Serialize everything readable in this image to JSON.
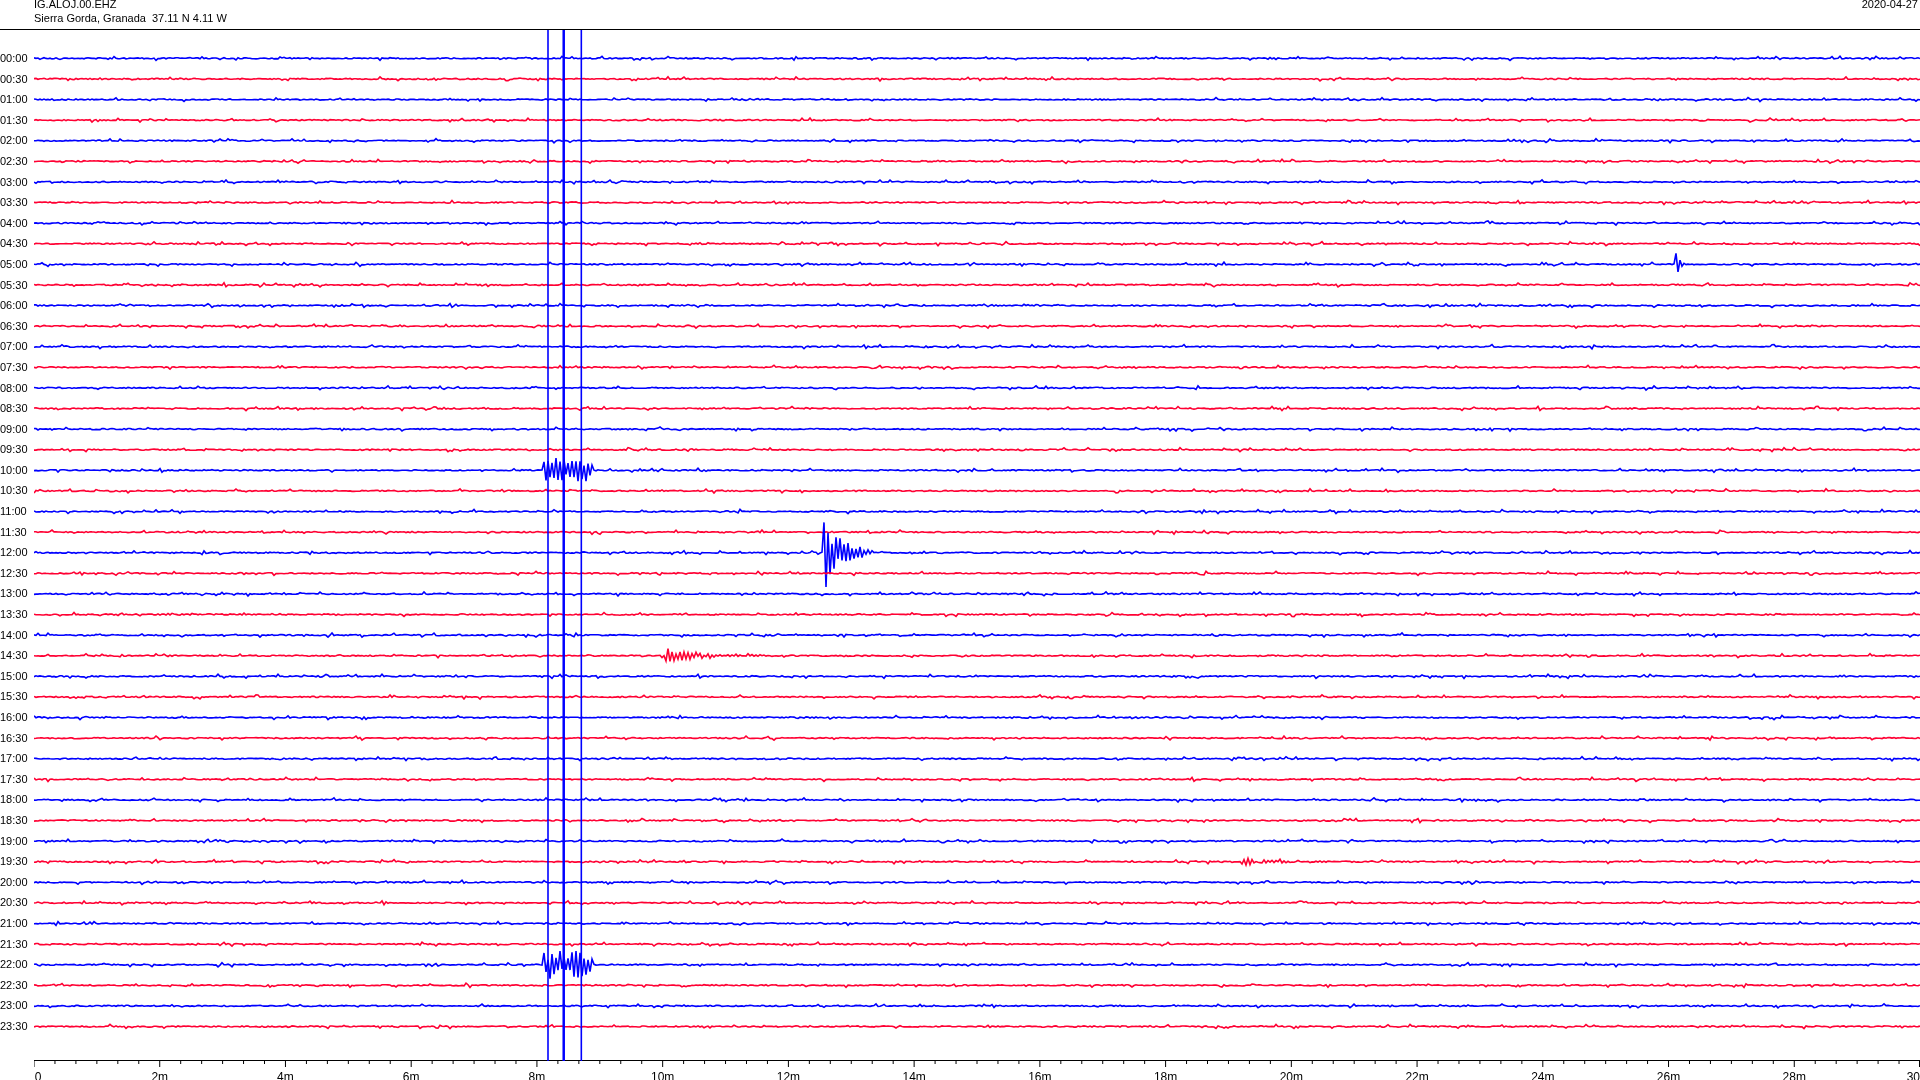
{
  "header": {
    "station": "IG.ALOJ.00.EHZ",
    "location": "Sierra Gorda, Granada  37.11 N 4.11 W",
    "date": "2020-04-27"
  },
  "rows": [
    {
      "time": "00:00",
      "color": "#0000ff"
    },
    {
      "time": "00:30",
      "color": "#ff0033"
    },
    {
      "time": "01:00",
      "color": "#0000ff"
    },
    {
      "time": "01:30",
      "color": "#ff0033"
    },
    {
      "time": "02:00",
      "color": "#0000ff"
    },
    {
      "time": "02:30",
      "color": "#ff0033"
    },
    {
      "time": "03:00",
      "color": "#0000ff"
    },
    {
      "time": "03:30",
      "color": "#ff0033"
    },
    {
      "time": "04:00",
      "color": "#0000ff"
    },
    {
      "time": "04:30",
      "color": "#ff0033"
    },
    {
      "time": "05:00",
      "color": "#0000ff"
    },
    {
      "time": "05:30",
      "color": "#ff0033"
    },
    {
      "time": "06:00",
      "color": "#0000ff"
    },
    {
      "time": "06:30",
      "color": "#ff0033"
    },
    {
      "time": "07:00",
      "color": "#0000ff"
    },
    {
      "time": "07:30",
      "color": "#ff0033"
    },
    {
      "time": "08:00",
      "color": "#0000ff"
    },
    {
      "time": "08:30",
      "color": "#ff0033"
    },
    {
      "time": "09:00",
      "color": "#0000ff"
    },
    {
      "time": "09:30",
      "color": "#ff0033"
    },
    {
      "time": "10:00",
      "color": "#0000ff"
    },
    {
      "time": "10:30",
      "color": "#ff0033"
    },
    {
      "time": "11:00",
      "color": "#0000ff"
    },
    {
      "time": "11:30",
      "color": "#ff0033"
    },
    {
      "time": "12:00",
      "color": "#0000ff"
    },
    {
      "time": "12:30",
      "color": "#ff0033"
    },
    {
      "time": "13:00",
      "color": "#0000ff"
    },
    {
      "time": "13:30",
      "color": "#ff0033"
    },
    {
      "time": "14:00",
      "color": "#0000ff"
    },
    {
      "time": "14:30",
      "color": "#ff0033"
    },
    {
      "time": "15:00",
      "color": "#0000ff"
    },
    {
      "time": "15:30",
      "color": "#ff0033"
    },
    {
      "time": "16:00",
      "color": "#0000ff"
    },
    {
      "time": "16:30",
      "color": "#ff0033"
    },
    {
      "time": "17:00",
      "color": "#0000ff"
    },
    {
      "time": "17:30",
      "color": "#ff0033"
    },
    {
      "time": "18:00",
      "color": "#0000ff"
    },
    {
      "time": "18:30",
      "color": "#ff0033"
    },
    {
      "time": "19:00",
      "color": "#0000ff"
    },
    {
      "time": "19:30",
      "color": "#ff0033"
    },
    {
      "time": "20:00",
      "color": "#0000ff"
    },
    {
      "time": "20:30",
      "color": "#ff0033"
    },
    {
      "time": "21:00",
      "color": "#0000ff"
    },
    {
      "time": "21:30",
      "color": "#ff0033"
    },
    {
      "time": "22:00",
      "color": "#0000ff"
    },
    {
      "time": "22:30",
      "color": "#ff0033"
    },
    {
      "time": "23:00",
      "color": "#0000ff"
    },
    {
      "time": "23:30",
      "color": "#ff0033"
    }
  ],
  "x_axis": {
    "labels": [
      "0",
      "2m",
      "4m",
      "6m",
      "8m",
      "10m",
      "12m",
      "14m",
      "16m",
      "18m",
      "20m",
      "22m",
      "24m",
      "26m",
      "28m",
      "30"
    ]
  }
}
